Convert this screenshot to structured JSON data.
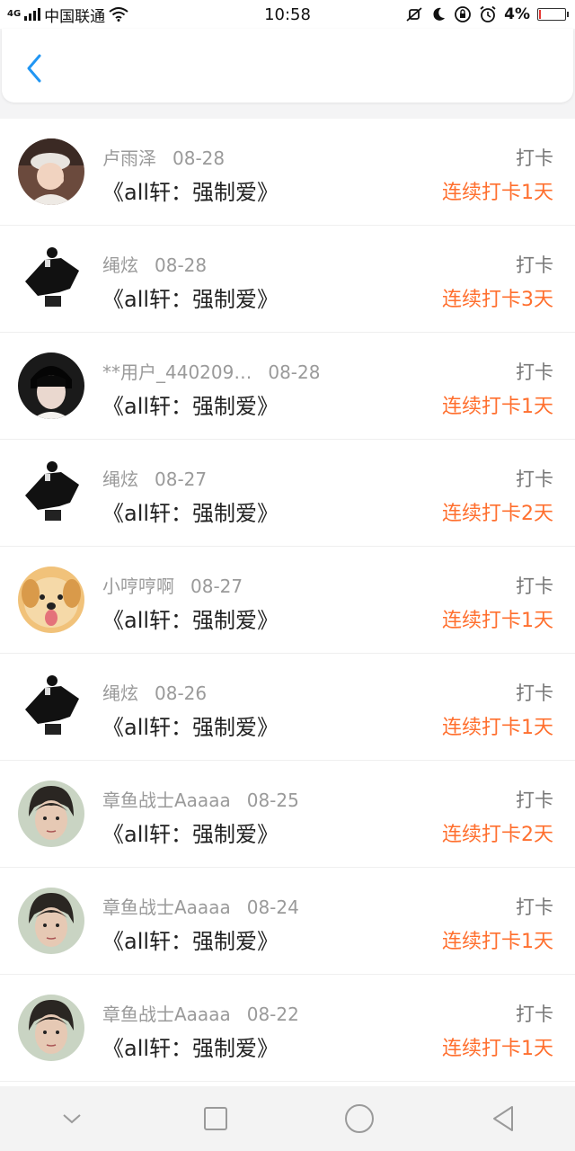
{
  "status_bar": {
    "carrier": "中国联通",
    "network": "4G",
    "time": "10:58",
    "battery": "4%",
    "battery_level": 0.04
  },
  "colors": {
    "accent_blue": "#2196f3",
    "streak_orange": "#ff6f2e"
  },
  "entries": [
    {
      "user": "卢雨泽",
      "date": "08-28",
      "title": "《all轩：强制爱》",
      "action": "打卡",
      "streak": "连续打卡1天",
      "avatar": "girl-hat-avatar"
    },
    {
      "user": "绳炫",
      "date": "08-28",
      "title": "《all轩：强制爱》",
      "action": "打卡",
      "streak": "连续打卡3天",
      "avatar": "figure-avatar"
    },
    {
      "user": "**用户_440209…",
      "date": "08-28",
      "title": "《all轩：强制爱》",
      "action": "打卡",
      "streak": "连续打卡1天",
      "avatar": "dark-portrait-avatar"
    },
    {
      "user": "绳炫",
      "date": "08-27",
      "title": "《all轩：强制爱》",
      "action": "打卡",
      "streak": "连续打卡2天",
      "avatar": "figure-avatar"
    },
    {
      "user": "小哼哼啊",
      "date": "08-27",
      "title": "《all轩：强制爱》",
      "action": "打卡",
      "streak": "连续打卡1天",
      "avatar": "dog-avatar"
    },
    {
      "user": "绳炫",
      "date": "08-26",
      "title": "《all轩：强制爱》",
      "action": "打卡",
      "streak": "连续打卡1天",
      "avatar": "figure-avatar"
    },
    {
      "user": "章鱼战士Aaaaa",
      "date": "08-25",
      "title": "《all轩：强制爱》",
      "action": "打卡",
      "streak": "连续打卡2天",
      "avatar": "boy-portrait-avatar"
    },
    {
      "user": "章鱼战士Aaaaa",
      "date": "08-24",
      "title": "《all轩：强制爱》",
      "action": "打卡",
      "streak": "连续打卡1天",
      "avatar": "boy-portrait-avatar"
    },
    {
      "user": "章鱼战士Aaaaa",
      "date": "08-22",
      "title": "《all轩：强制爱》",
      "action": "打卡",
      "streak": "连续打卡1天",
      "avatar": "boy-portrait-avatar"
    }
  ],
  "nav": {
    "icons": [
      "chevron-down-icon",
      "recents-square-icon",
      "home-circle-icon",
      "back-triangle-icon"
    ]
  }
}
